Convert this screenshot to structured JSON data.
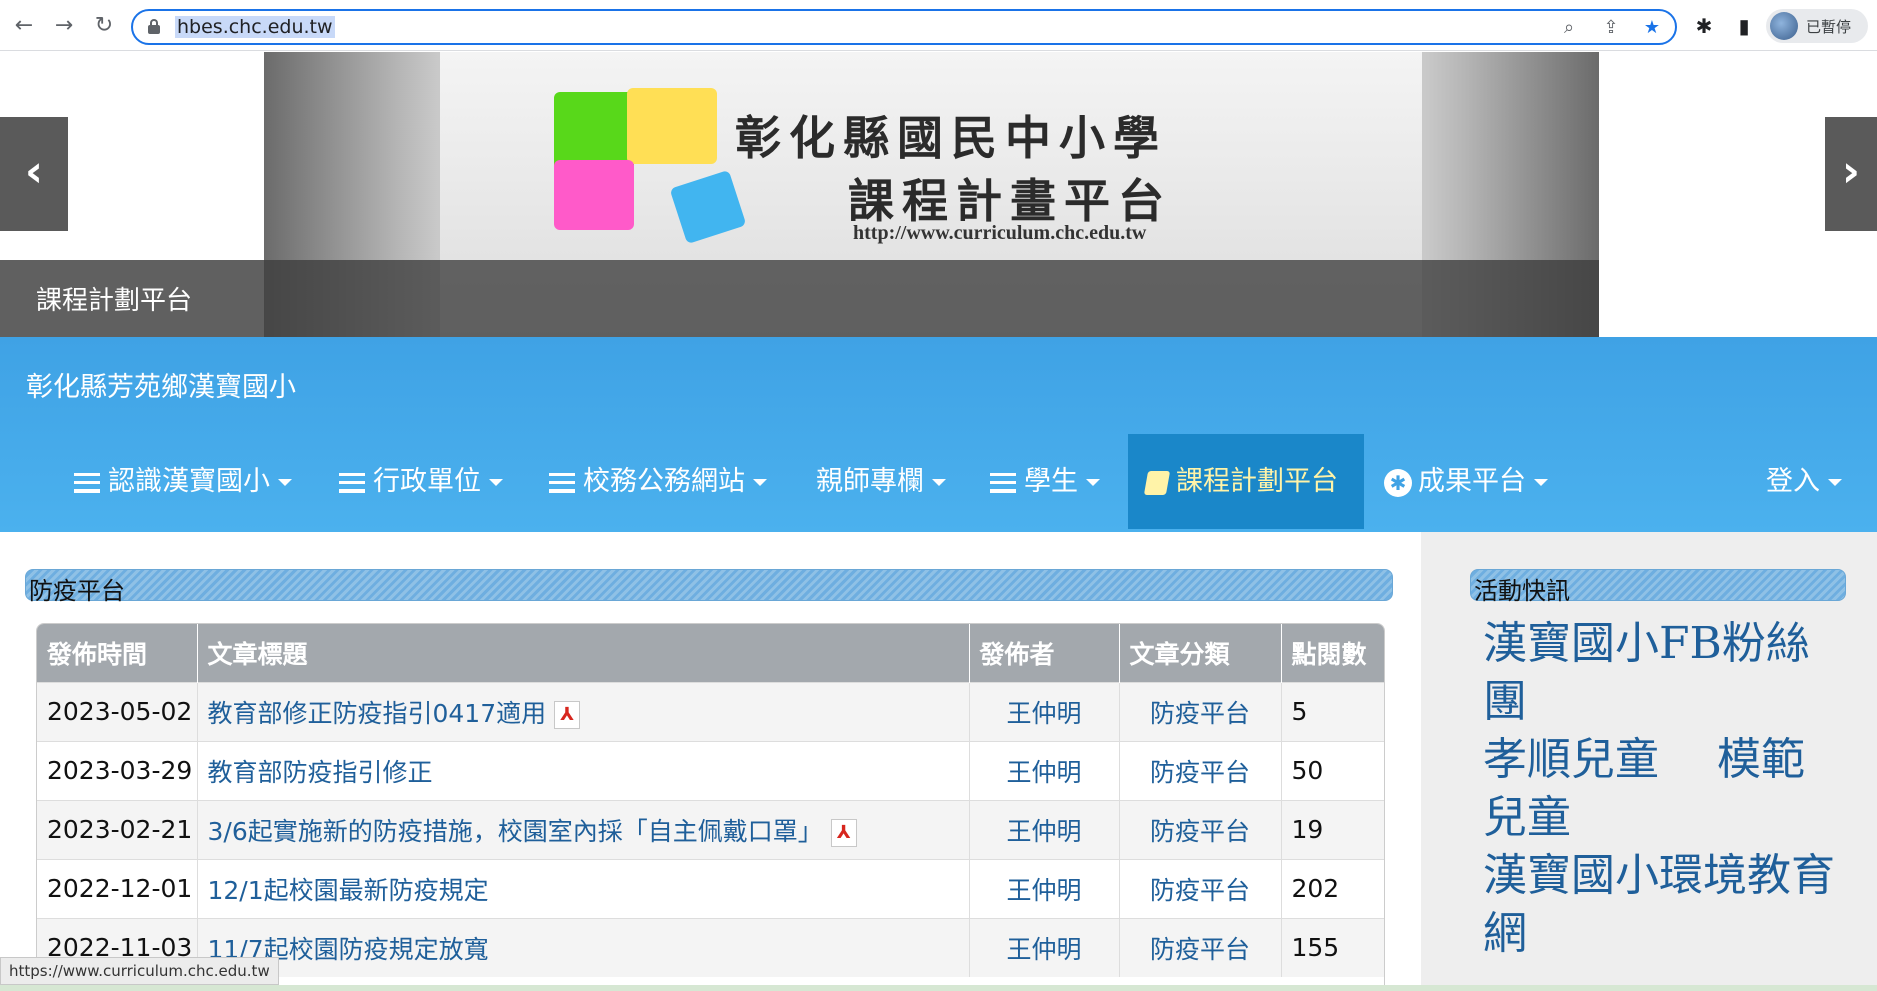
{
  "browser": {
    "url": "hbes.chc.edu.tw",
    "back_icon": "arrow-left-icon",
    "forward_icon": "arrow-right-icon",
    "reload_icon": "reload-icon",
    "profile_label": "已暫停"
  },
  "banner": {
    "title_line1": "彰化縣國民中小學",
    "title_line2": "課程計畫平台",
    "url_text": "http://www.curriculum.chc.edu.tw",
    "caption": "課程計劃平台",
    "prev_arrow": "‹",
    "next_arrow": "›"
  },
  "header": {
    "school_name": "彰化縣芳苑鄉漢寶國小",
    "menu": [
      {
        "label": "認識漢寶國小"
      },
      {
        "label": "行政單位"
      },
      {
        "label": "校務公務網站"
      },
      {
        "label": "親師專欄"
      },
      {
        "label": "學生"
      },
      {
        "label": "課程計劃平台"
      },
      {
        "label": "成果平台"
      },
      {
        "label": "登入"
      }
    ],
    "active_color": "#1a87c9"
  },
  "main": {
    "section_title": "防疫平台",
    "columns": [
      "發佈時間",
      "文章標題",
      "發佈者",
      "文章分類",
      "點閱數"
    ],
    "rows": [
      {
        "date": "2023-05-02",
        "title": "教育部修正防疫指引0417適用",
        "author": "王仲明",
        "category": "防疫平台",
        "views": "5",
        "pdf": true
      },
      {
        "date": "2023-03-29",
        "title": "教育部防疫指引修正",
        "author": "王仲明",
        "category": "防疫平台",
        "views": "50",
        "pdf": false
      },
      {
        "date": "2023-02-21",
        "title": "3/6起實施新的防疫措施，校園室內採「自主佩戴口罩」",
        "author": "王仲明",
        "category": "防疫平台",
        "views": "19",
        "pdf": true
      },
      {
        "date": "2022-12-01",
        "title": "12/1起校園最新防疫規定",
        "author": "王仲明",
        "category": "防疫平台",
        "views": "202",
        "pdf": false
      },
      {
        "date": "2022-11-03",
        "title": "11/7起校園防疫規定放寬",
        "author": "王仲明",
        "category": "防疫平台",
        "views": "155",
        "pdf": false
      }
    ]
  },
  "sidebar": {
    "section_title": "活動快訊",
    "links": [
      "漢寶國小FB粉絲團",
      "孝順兒童　 模範兒童",
      "漢寶國小環境教育網"
    ]
  },
  "status_bar": {
    "text": "https://www.curriculum.chc.edu.tw"
  }
}
